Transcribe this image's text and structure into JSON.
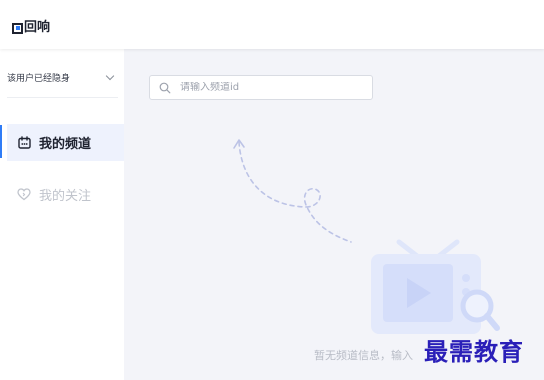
{
  "app": {
    "title": "回响",
    "accent_color": "#2f7cf6"
  },
  "sidebar": {
    "status": {
      "label": "该用户已经隐身",
      "icon": "chevron-down-icon"
    },
    "items": [
      {
        "label": "我的频道",
        "icon": "calendar-icon",
        "active": true
      },
      {
        "label": "我的关注",
        "icon": "heart-icon",
        "active": false
      }
    ]
  },
  "main": {
    "search": {
      "placeholder": "请输入频道id",
      "value": "",
      "icon": "search-icon"
    },
    "empty_state": {
      "message": "暂无频道信息，输入",
      "illustration": "tv-play-search-icon"
    }
  },
  "watermark": {
    "text": "最需教育"
  }
}
